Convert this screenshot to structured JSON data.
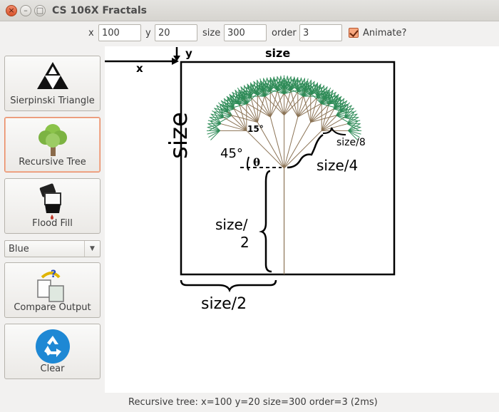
{
  "window": {
    "title": "CS 106X Fractals",
    "close_glyph": "×",
    "min_glyph": "–",
    "max_glyph": "□"
  },
  "toolbar": {
    "x_label": "x",
    "x_value": "100",
    "y_label": "y",
    "y_value": "20",
    "size_label": "size",
    "size_value": "300",
    "order_label": "order",
    "order_value": "3",
    "animate_label": "Animate?",
    "animate_checked": true
  },
  "sidebar": {
    "buttons": [
      {
        "label": "Sierpinski Triangle",
        "icon": "sierpinski-icon"
      },
      {
        "label": "Recursive Tree",
        "icon": "tree-icon",
        "active": true
      },
      {
        "label": "Flood Fill",
        "icon": "paint-brush-icon"
      },
      {
        "label": "Compare Output",
        "icon": "compare-icon"
      },
      {
        "label": "Clear",
        "icon": "recycle-icon"
      }
    ],
    "color_select": {
      "value": "Blue",
      "arrow": "▼"
    }
  },
  "diagram": {
    "label_x": "x",
    "label_y": "y",
    "label_size_top": "size",
    "label_size_left": "size",
    "label_half_left": "size/",
    "label_half_left_2": "2",
    "label_half_bottom": "size/2",
    "label_quarter": "size/4",
    "label_eighth": "size/8",
    "label_45": "45°",
    "label_theta": "θ",
    "label_15": "15°"
  },
  "colors": {
    "branch": "#2e8b57",
    "trunk": "#8b7355",
    "accent": "#e88a64",
    "ink": "#000000"
  },
  "status": {
    "text": "Recursive tree: x=100 y=20 size=300 order=3 (2ms)"
  }
}
